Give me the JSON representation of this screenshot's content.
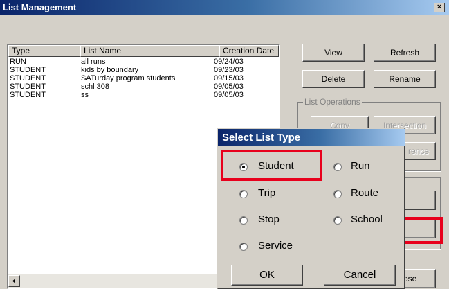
{
  "window": {
    "title": "List Management",
    "close_glyph": "×"
  },
  "list": {
    "columns": [
      "Type",
      "List Name",
      "Creation Date"
    ],
    "rows": [
      [
        "RUN",
        "all runs",
        "09/24/03"
      ],
      [
        "STUDENT",
        "kids by boundary",
        "09/23/03"
      ],
      [
        "STUDENT",
        "SATurday program students",
        "09/15/03"
      ],
      [
        "STUDENT",
        "schl 308",
        "09/05/03"
      ],
      [
        "STUDENT",
        "ss",
        "09/05/03"
      ]
    ]
  },
  "buttons": {
    "view": "View",
    "refresh": "Refresh",
    "delete": "Delete",
    "rename": "Rename",
    "copy": "Copy",
    "intersection": "Intersection",
    "difference_partial": "rence",
    "close_partial": "ose"
  },
  "list_operations_label": "List Operations",
  "dialog": {
    "title": "Select List Type",
    "options": [
      "Student",
      "Run",
      "Trip",
      "Route",
      "Stop",
      "School",
      "Service"
    ],
    "selected": "Student",
    "ok": "OK",
    "cancel": "Cancel"
  },
  "colors": {
    "highlight": "#e8001c",
    "title_start": "#0a246a"
  },
  "icons": {
    "close": "close-icon",
    "radio": "radio-icon"
  }
}
